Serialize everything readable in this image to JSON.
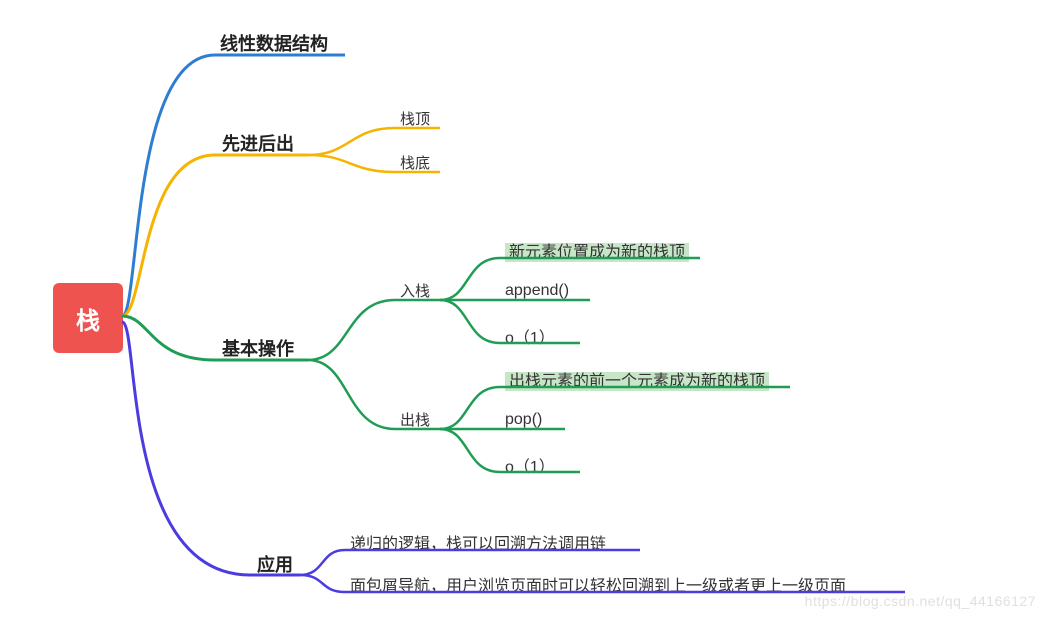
{
  "root": {
    "label": "栈"
  },
  "branches": {
    "linear": {
      "label": "线性数据结构",
      "color": "#2f7dd1"
    },
    "filo": {
      "label": "先进后出",
      "color": "#f4b400",
      "children": {
        "top": "栈顶",
        "bottom": "栈底"
      }
    },
    "ops": {
      "label": "基本操作",
      "color": "#1f9d55",
      "push": {
        "label": "入栈",
        "items": {
          "desc": "新元素位置成为新的栈顶",
          "fn": "append()",
          "big_o": "o（1）"
        }
      },
      "pop": {
        "label": "出栈",
        "items": {
          "desc": "出栈元素的前一个元素成为新的栈顶",
          "fn": "pop()",
          "big_o": "o（1）"
        }
      }
    },
    "app": {
      "label": "应用",
      "color": "#4b3ce0",
      "children": {
        "recursion": "递归的逻辑，栈可以回溯方法调用链",
        "breadcrumb": "面包屑导航，用户浏览页面时可以轻松回溯到上一级或者更上一级页面"
      }
    }
  },
  "watermark": "https://blog.csdn.net/qq_44166127"
}
